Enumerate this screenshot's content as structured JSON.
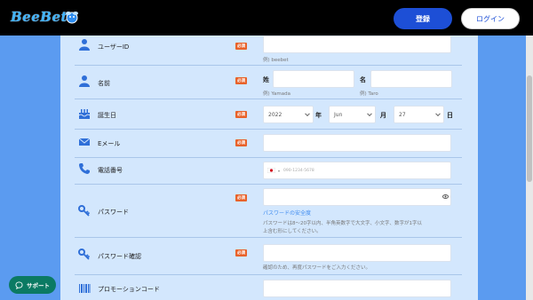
{
  "header": {
    "logo_text": "BeeBet",
    "register_label": "登録",
    "login_label": "ログイン"
  },
  "form": {
    "required_badge": "必須",
    "user_id": {
      "label": "ユーザーID",
      "value": "",
      "example": "例) beebet",
      "icon": "person-icon"
    },
    "name": {
      "label": "名前",
      "icon": "person-icon",
      "last_label": "姓",
      "last_example": "例) Yamada",
      "first_label": "名",
      "first_example": "例) Taro"
    },
    "birthday": {
      "label": "誕生日",
      "icon": "cake-icon",
      "year": "2022",
      "year_unit": "年",
      "month": "Jun",
      "month_unit": "月",
      "day": "27",
      "day_unit": "日"
    },
    "email": {
      "label": "Eメール",
      "icon": "mail-icon"
    },
    "phone": {
      "label": "電話番号",
      "icon": "phone-icon",
      "placeholder": "090-1234-5678",
      "flag": "japan-flag-icon"
    },
    "password": {
      "label": "パスワード",
      "icon": "key-icon",
      "strength_link": "パスワードの安全度",
      "hint_line1": "パスワードは8〜20字以内、半角英数字で大文字、小文字、数字が1字以",
      "hint_line2": "上含む形にしてください。"
    },
    "password_confirm": {
      "label": "パスワード確認",
      "icon": "key-icon",
      "hint": "確認のため、再度パスワードをご入力ください。"
    },
    "promo": {
      "label": "プロモーションコード",
      "icon": "barcode-icon"
    }
  },
  "support": {
    "label": "サポート",
    "icon": "chat-icon"
  },
  "colors": {
    "background": "#5b9bf0",
    "panel": "#d3e7fd",
    "accent": "#1d4fd6",
    "required": "#e8622a",
    "support": "#0b7a63"
  }
}
